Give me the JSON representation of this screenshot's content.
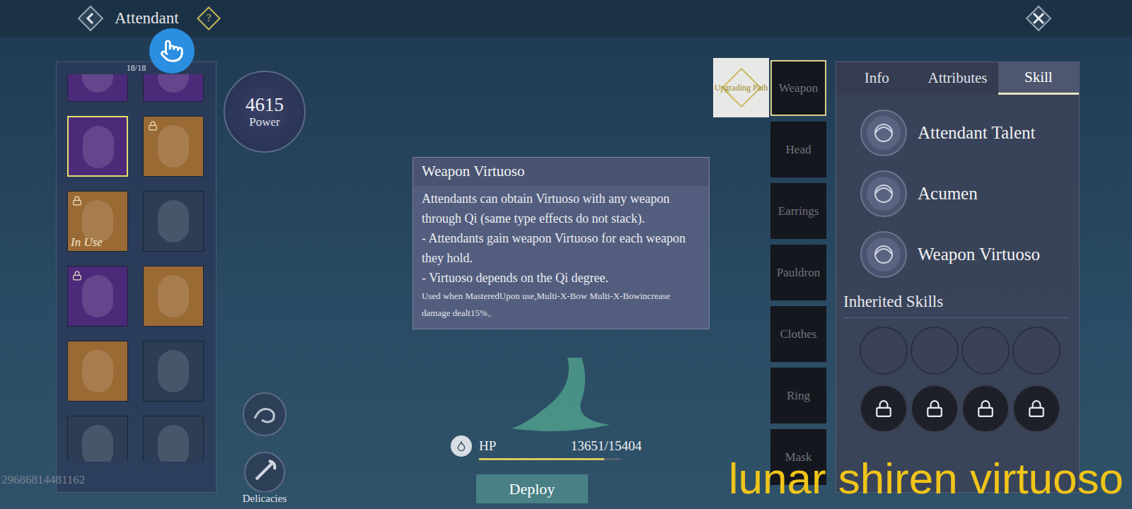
{
  "header": {
    "title": "Attendant",
    "help_icon": "?"
  },
  "roster": {
    "count": "18/18",
    "attendants": [
      {
        "color": "#4b2a7a",
        "locked": false,
        "in_use": false,
        "selected": false
      },
      {
        "color": "#4b2a7a",
        "locked": false,
        "in_use": false,
        "selected": false
      },
      {
        "color": "#4b2a7a",
        "locked": false,
        "in_use": false,
        "selected": true
      },
      {
        "color": "#9a6a35",
        "locked": true,
        "in_use": false,
        "selected": false
      },
      {
        "color": "#9a6a35",
        "locked": true,
        "in_use": true,
        "selected": false
      },
      {
        "color": "#2c3d55",
        "locked": false,
        "in_use": false,
        "selected": false
      },
      {
        "color": "#4b2a7a",
        "locked": true,
        "in_use": false,
        "selected": false
      },
      {
        "color": "#9a6a35",
        "locked": false,
        "in_use": false,
        "selected": false
      },
      {
        "color": "#9a6a35",
        "locked": false,
        "in_use": false,
        "selected": false
      },
      {
        "color": "#2c3d55",
        "locked": false,
        "in_use": false,
        "selected": false
      },
      {
        "color": "#2c3d55",
        "locked": false,
        "in_use": false,
        "selected": false
      },
      {
        "color": "#2c3d55",
        "locked": false,
        "in_use": false,
        "selected": false
      }
    ],
    "in_use_label": "In Use"
  },
  "account_id": "29686814481162",
  "power": {
    "value": "4615",
    "label": "Power"
  },
  "delicacies": {
    "label": "Delicacies"
  },
  "tooltip": {
    "title": "Weapon Virtuoso",
    "lines": [
      "Attendants can obtain Virtuoso with any weapon through Qi (same type effects do not stack).",
      "- Attendants gain weapon Virtuoso for each weapon they hold.",
      "- Virtuoso depends on the Qi degree."
    ],
    "note": "Used when MasteredUpon use,Multi-X-Bow Multi-X-Bowincrease damage dealt15%。"
  },
  "hp": {
    "label": "HP",
    "reading": "13651/15404",
    "level": 0.886
  },
  "deploy_button": "Deploy",
  "equipment": {
    "upgrade_tile": "Upgrading Path",
    "slots": [
      {
        "label": "Weapon",
        "selected": true
      },
      {
        "label": "Head",
        "selected": false
      },
      {
        "label": "Earrings",
        "selected": false
      },
      {
        "label": "Pauldron",
        "selected": false
      },
      {
        "label": "Clothes",
        "selected": false
      },
      {
        "label": "Ring",
        "selected": false
      },
      {
        "label": "Mask",
        "selected": false
      }
    ]
  },
  "detail_panel": {
    "tabs": [
      {
        "label": "Info",
        "selected": false
      },
      {
        "label": "Attributes",
        "selected": false
      },
      {
        "label": "Skill",
        "selected": true
      }
    ],
    "skills": [
      "Attendant Talent",
      "Acumen",
      "Weapon Virtuoso"
    ],
    "inherited": {
      "title": "Inherited Skills",
      "slots": [
        {
          "locked": false
        },
        {
          "locked": false
        },
        {
          "locked": false
        },
        {
          "locked": false
        },
        {
          "locked": true
        },
        {
          "locked": true
        },
        {
          "locked": true
        },
        {
          "locked": true
        }
      ]
    }
  },
  "watermark": "lunar shiren virtuoso"
}
